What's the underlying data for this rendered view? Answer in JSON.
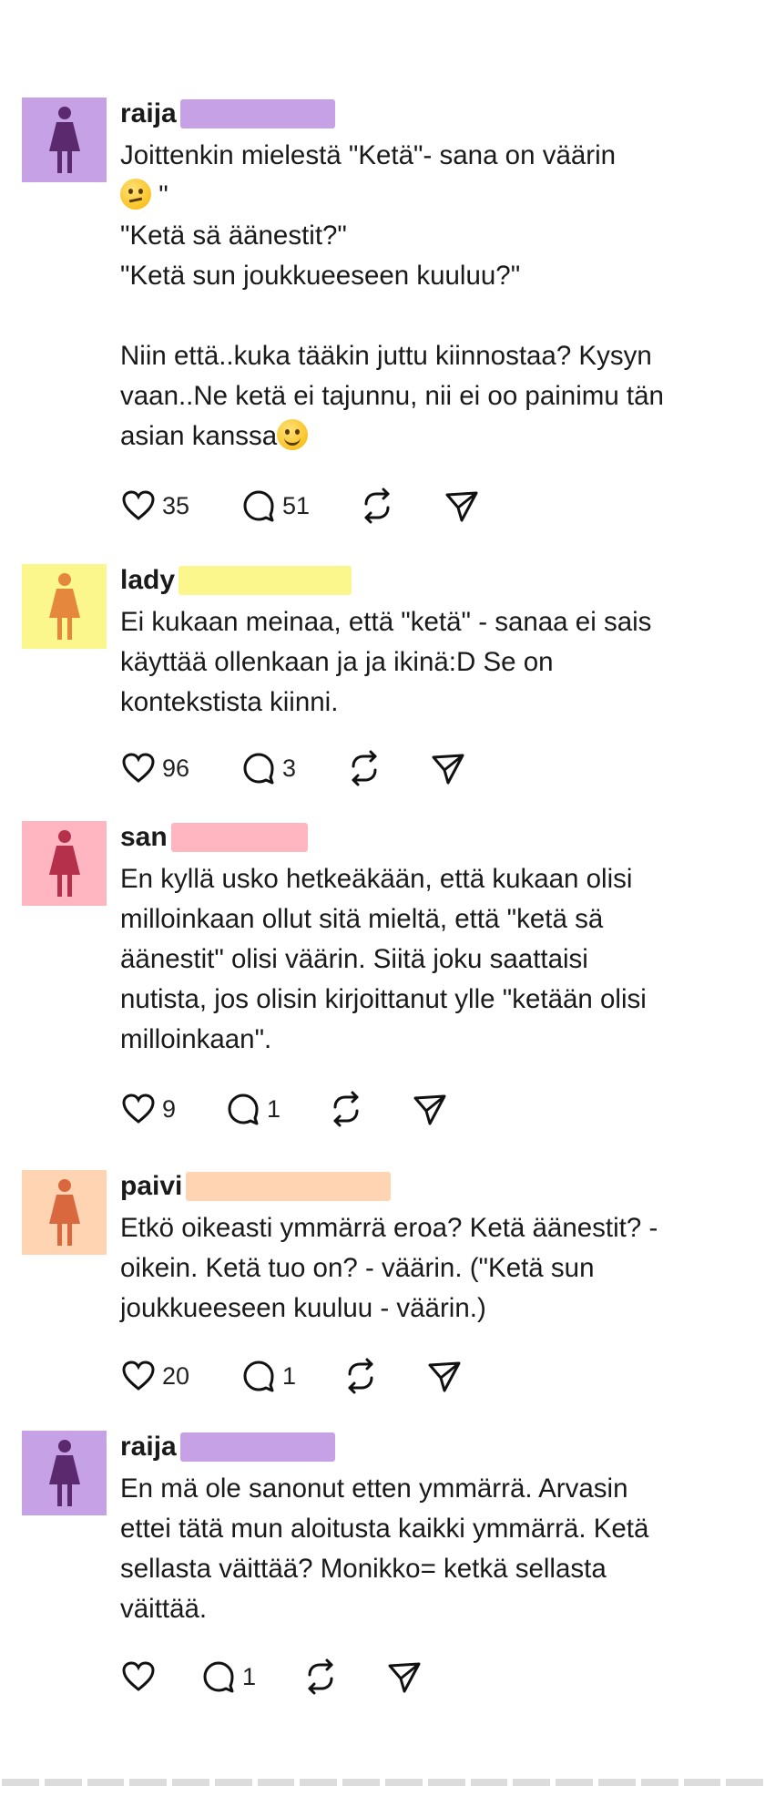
{
  "posts": [
    {
      "username": "raija",
      "avatar_color": "#c6a1e6",
      "figure_color": "#5b2a6e",
      "redact_color": "#c6a1e6",
      "body_lines": [
        "Joittenkin mielestä \"Ketä\"- sana on väärin",
        "\"",
        "\"Ketä sä äänestit?\"",
        "\"Ketä sun joukkueeseen kuuluu?\"",
        "",
        "Niin että..kuka tääkin juttu kiinnostaa? Kysyn",
        "vaan..Ne ketä ei tajunnu, nii ei oo painimu tän",
        "asian kanssa"
      ],
      "likes": "35",
      "comments": "51"
    },
    {
      "username": "lady",
      "avatar_color": "#fbf78c",
      "figure_color": "#e5873c",
      "redact_color": "#fbf78c",
      "body_lines": [
        "Ei kukaan meinaa, että \"ketä\" - sanaa ei sais",
        "käyttää ollenkaan ja ja ikinä:D Se on",
        "kontekstista kiinni."
      ],
      "likes": "96",
      "comments": "3"
    },
    {
      "username": "san",
      "avatar_color": "#ffb6c1",
      "figure_color": "#b5304b",
      "redact_color": "#ffb6c1",
      "body_lines": [
        "En kyllä usko hetkeäkään, että kukaan olisi",
        "milloinkaan ollut sitä mieltä, että \"ketä sä",
        "äänestit\" olisi väärin. Siitä joku saattaisi",
        "nutista, jos olisin kirjoittanut ylle \"ketään olisi",
        "milloinkaan\"."
      ],
      "likes": "9",
      "comments": "1"
    },
    {
      "username": "paivi",
      "avatar_color": "#ffd4b3",
      "figure_color": "#d9683f",
      "redact_color": "#ffd4b3",
      "body_lines": [
        "Etkö oikeasti ymmärrä eroa? Ketä äänestit? -",
        "oikein. Ketä tuo on? - väärin. (\"Ketä sun",
        "joukkueeseen kuuluu - väärin.)"
      ],
      "likes": "20",
      "comments": "1"
    },
    {
      "username": "raija",
      "avatar_color": "#c6a1e6",
      "figure_color": "#5b2a6e",
      "redact_color": "#c6a1e6",
      "body_lines": [
        "En mä ole sanonut etten ymmärrä. Arvasin",
        "ettei tätä mun aloitusta kaikki ymmärrä. Ketä",
        "sellasta väittää? Monikko= ketkä sellasta",
        "väittää."
      ],
      "likes": "",
      "comments": "1"
    }
  ],
  "icons": {
    "like": "heart-icon",
    "comment": "comment-bubble-icon",
    "repost": "repost-icon",
    "share": "send-icon"
  }
}
